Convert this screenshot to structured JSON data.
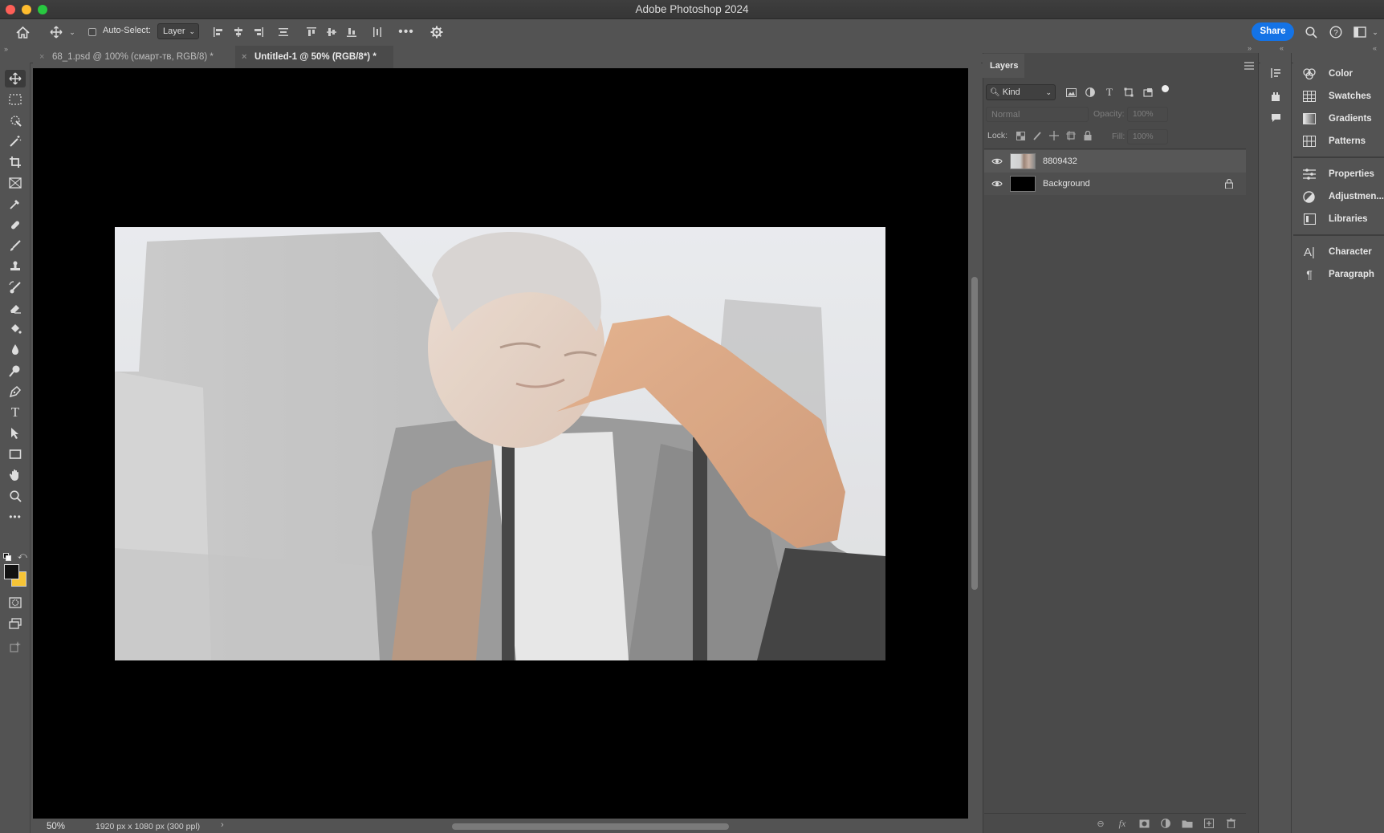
{
  "window": {
    "title": "Adobe Photoshop 2024",
    "traffic_colors": [
      "#fe5f57",
      "#febc2e",
      "#28c840"
    ]
  },
  "options": {
    "auto_select_label": "Auto-Select:",
    "auto_select_target": "Layer",
    "share_label": "Share"
  },
  "tabs": [
    {
      "label": "68_1.psd @ 100% (смарт-тв, RGB/8) *",
      "active": false
    },
    {
      "label": "Untitled-1 @ 50% (RGB/8*) *",
      "active": true
    }
  ],
  "layers_panel": {
    "tab_label": "Layers",
    "filter_kind": "Kind",
    "blend_mode": "Normal",
    "opacity_label": "Opacity:",
    "opacity_value": "100%",
    "lock_label": "Lock:",
    "fill_label": "Fill:",
    "fill_value": "100%",
    "layers": [
      {
        "name": "8809432",
        "visible": true,
        "locked": false
      },
      {
        "name": "Background",
        "visible": true,
        "locked": true
      }
    ]
  },
  "right_panels": {
    "group1": [
      "Color",
      "Swatches",
      "Gradients",
      "Patterns"
    ],
    "group2": [
      "Properties",
      "Adjustmen...",
      "Libraries"
    ],
    "group3": [
      "Character",
      "Paragraph"
    ]
  },
  "status": {
    "zoom": "50%",
    "doc_info": "1920 px x 1080 px (300 ppl)"
  },
  "colors": {
    "foreground": "#111111",
    "background": "#f6c436",
    "accent": "#1473e6"
  }
}
